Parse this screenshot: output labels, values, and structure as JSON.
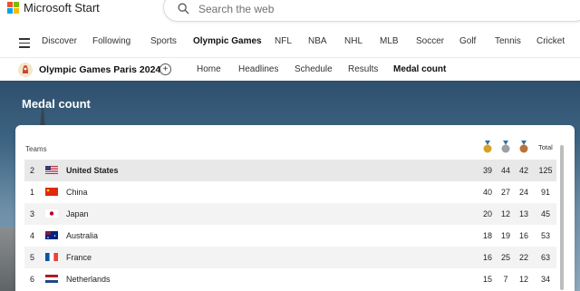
{
  "app": {
    "name": "Microsoft Start"
  },
  "search": {
    "placeholder": "Search the web"
  },
  "category_nav": [
    "Discover",
    "Following",
    "Sports",
    "Olympic Games",
    "NFL",
    "NBA",
    "NHL",
    "MLB",
    "Soccer",
    "Golf",
    "Tennis",
    "Cricket"
  ],
  "category_active": "Olympic Games",
  "olympics": {
    "title": "Olympic Games Paris 2024",
    "tabs": [
      "Home",
      "Headlines",
      "Schedule",
      "Results",
      "Medal count"
    ],
    "active_tab": "Medal count"
  },
  "hero": {
    "title": "Medal count"
  },
  "table": {
    "teams_label": "Teams",
    "total_label": "Total",
    "medal_colors": {
      "gold": "#d4a326",
      "silver": "#9aa0a6",
      "bronze": "#b8733b"
    },
    "rows": [
      {
        "rank": "2",
        "country": "United States",
        "flag": "us",
        "gold": "39",
        "silver": "44",
        "bronze": "42",
        "total": "125"
      },
      {
        "rank": "1",
        "country": "China",
        "flag": "cn",
        "gold": "40",
        "silver": "27",
        "bronze": "24",
        "total": "91"
      },
      {
        "rank": "3",
        "country": "Japan",
        "flag": "jp",
        "gold": "20",
        "silver": "12",
        "bronze": "13",
        "total": "45"
      },
      {
        "rank": "4",
        "country": "Australia",
        "flag": "au",
        "gold": "18",
        "silver": "19",
        "bronze": "16",
        "total": "53"
      },
      {
        "rank": "5",
        "country": "France",
        "flag": "fr",
        "gold": "16",
        "silver": "25",
        "bronze": "22",
        "total": "63"
      },
      {
        "rank": "6",
        "country": "Netherlands",
        "flag": "nl",
        "gold": "15",
        "silver": "7",
        "bronze": "12",
        "total": "34"
      }
    ]
  }
}
